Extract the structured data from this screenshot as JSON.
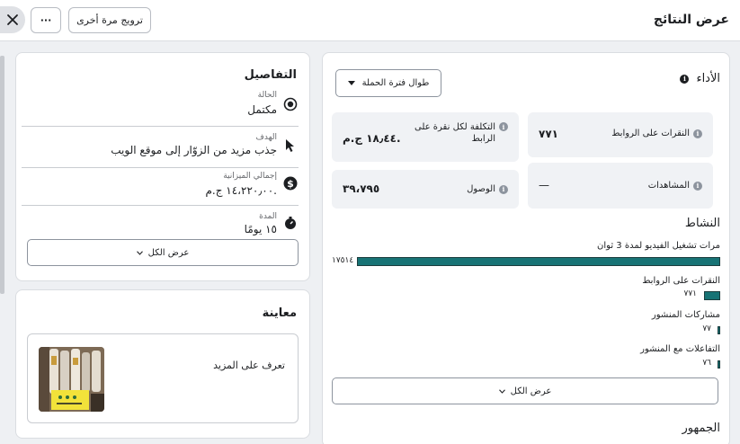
{
  "header": {
    "title": "عرض النتائج",
    "boost_again": "ترويج مرة أخرى",
    "more_glyph": "···"
  },
  "details": {
    "title": "التفاصيل",
    "rows": [
      {
        "label": "الحالة",
        "value": "مكتمل",
        "icon": "status-icon"
      },
      {
        "label": "الهدف",
        "value": "جذب مزيد من الزوّار إلى موقع الويب",
        "icon": "cursor-icon"
      },
      {
        "label": "إجمالي الميزانية",
        "value": "١٤،٢٢٠٫٠٠ ج.م.",
        "icon": "dollar-icon"
      },
      {
        "label": "المدة",
        "value": "١٥ يومًا",
        "icon": "stopwatch-icon"
      }
    ],
    "view_all": "عرض الكل"
  },
  "preview": {
    "title": "معاينة",
    "cta": "تعرف على المزيد"
  },
  "performance": {
    "title": "الأداء",
    "period": "طوال فترة الحملة",
    "metrics": {
      "link_clicks": {
        "label": "النقرات على الروابط",
        "value": "٧٧١"
      },
      "cpc": {
        "label": "التكلفة لكل نقرة على الرابط",
        "value": "١٨٫٤٤ ج.م."
      },
      "views": {
        "label": "المشاهدات",
        "value": "—"
      },
      "reach": {
        "label": "الوصول",
        "value": "٣٩،٧٩٥"
      }
    },
    "activity_title": "النشاط",
    "activity": [
      {
        "label": "مرات تشغيل الفيديو لمدة 3 ثوان",
        "value": "١٧٥١٤",
        "raw": 17514
      },
      {
        "label": "النقرات على الروابط",
        "value": "٧٧١",
        "raw": 771
      },
      {
        "label": "مشاركات المنشور",
        "value": "٧٧",
        "raw": 77
      },
      {
        "label": "التفاعلات مع المنشور",
        "value": "٧٦",
        "raw": 76
      }
    ],
    "view_all": "عرض الكل",
    "audience_title": "الجمهور",
    "accent": "#177375"
  }
}
